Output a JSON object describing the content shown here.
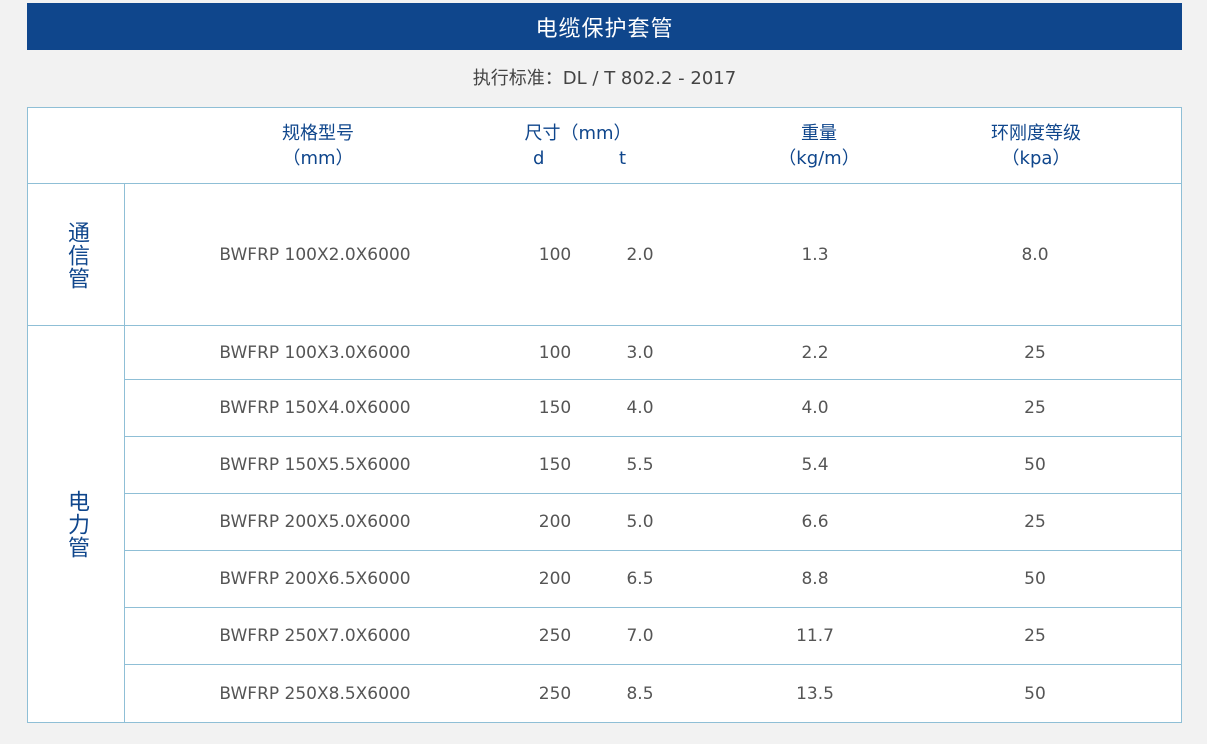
{
  "title": "电缆保护套管",
  "standard": "执行标准：DL / T 802.2 - 2017",
  "headers": {
    "spec": "规格型号",
    "spec_unit": "（mm）",
    "size": "尺寸（mm）",
    "d": "d",
    "t": "t",
    "weight": "重量",
    "weight_unit": "（kg/m）",
    "stiffness": "环刚度等级",
    "stiffness_unit": "（kpa）"
  },
  "groups": [
    {
      "category": "通信管",
      "rows": [
        {
          "spec": "BWFRP 100X2.0X6000",
          "d": "100",
          "t": "2.0",
          "weight": "1.3",
          "stiffness": "8.0"
        }
      ]
    },
    {
      "category": "电力管",
      "rows": [
        {
          "spec": "BWFRP 100X3.0X6000",
          "d": "100",
          "t": "3.0",
          "weight": "2.2",
          "stiffness": "25"
        },
        {
          "spec": "BWFRP 150X4.0X6000",
          "d": "150",
          "t": "4.0",
          "weight": "4.0",
          "stiffness": "25"
        },
        {
          "spec": "BWFRP 150X5.5X6000",
          "d": "150",
          "t": "5.5",
          "weight": "5.4",
          "stiffness": "50"
        },
        {
          "spec": "BWFRP 200X5.0X6000",
          "d": "200",
          "t": "5.0",
          "weight": "6.6",
          "stiffness": "25"
        },
        {
          "spec": "BWFRP 200X6.5X6000",
          "d": "200",
          "t": "6.5",
          "weight": "8.8",
          "stiffness": "50"
        },
        {
          "spec": "BWFRP 250X7.0X6000",
          "d": "250",
          "t": "7.0",
          "weight": "11.7",
          "stiffness": "25"
        },
        {
          "spec": "BWFRP 250X8.5X6000",
          "d": "250",
          "t": "8.5",
          "weight": "13.5",
          "stiffness": "50"
        }
      ]
    }
  ]
}
